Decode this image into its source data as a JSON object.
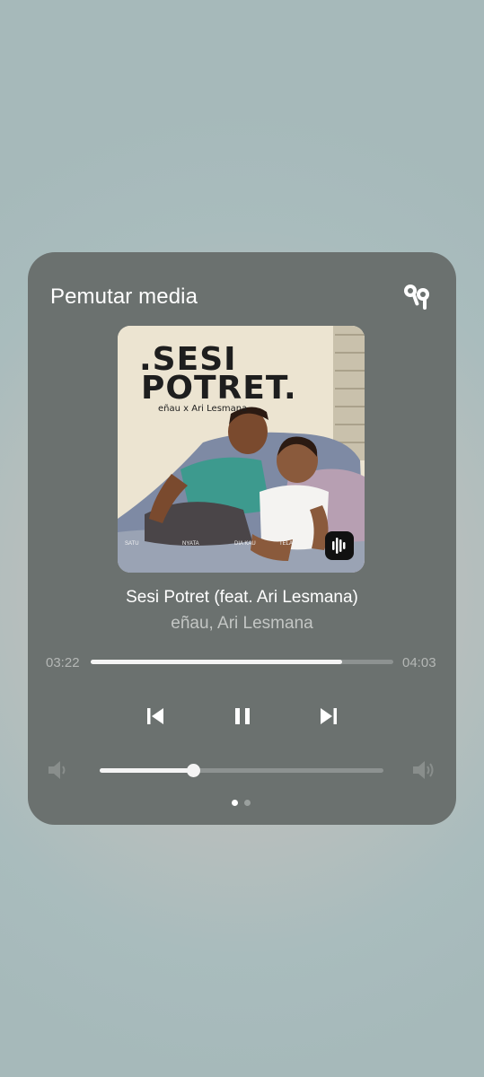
{
  "panel": {
    "title": "Pemutar media"
  },
  "album_art": {
    "title_line1": ".SESI",
    "title_line2": "POTRET.",
    "artists_line": "eñau x Ari Lesmana",
    "tracklist": [
      "SATU",
      "NYATA",
      "DIA KAU",
      "TELAH"
    ],
    "app_icon": "waveform-app-icon"
  },
  "track": {
    "title": "Sesi Potret (feat. Ari Lesmana)",
    "artist": "eñau, Ari Lesmana"
  },
  "progress": {
    "current": "03:22",
    "total": "04:03",
    "fraction": 0.831
  },
  "controls": {
    "previous": "skip-previous-icon",
    "pause": "pause-icon",
    "next": "skip-next-icon",
    "output": "earbuds-icon"
  },
  "volume": {
    "level": 0.33,
    "min_icon": "volume-low-icon",
    "max_icon": "volume-high-icon"
  },
  "pager": {
    "count": 2,
    "active": 0
  },
  "colors": {
    "card": "#6b716f",
    "accent": "#ffffff",
    "track_bg": "#8d9291"
  }
}
